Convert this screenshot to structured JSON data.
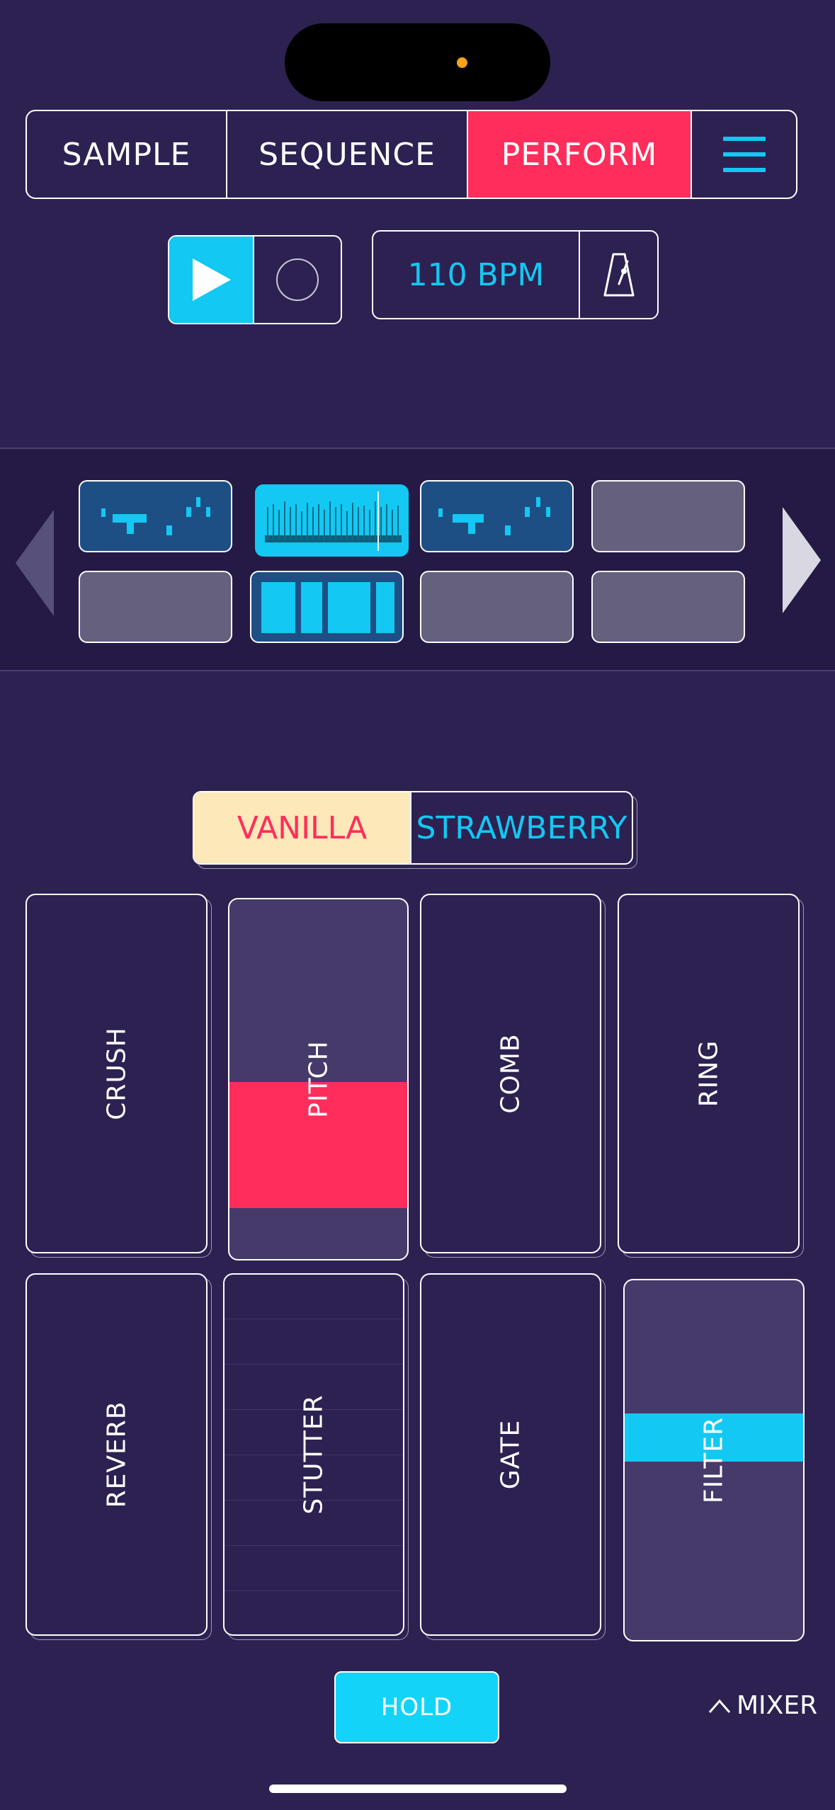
{
  "tabs": {
    "sample": "SAMPLE",
    "sequence": "SEQUENCE",
    "perform": "PERFORM"
  },
  "transport": {
    "bpm": "110 BPM"
  },
  "flavor_toggle": {
    "vanilla": "VANILLA",
    "strawberry": "STRAWBERRY",
    "selected": "VANILLA"
  },
  "effects": {
    "crush": "CRUSH",
    "pitch": "PITCH",
    "comb": "COMB",
    "ring": "RING",
    "reverb": "REVERB",
    "stutter": "STUTTER",
    "gate": "GATE",
    "filter": "FILTER"
  },
  "footer": {
    "hold": "HOLD",
    "mixer": "MIXER"
  },
  "colors": {
    "background": "#2d2152",
    "accent_pink": "#ff2d5c",
    "accent_cyan": "#13c8f2",
    "vanilla": "#fce8b8"
  }
}
